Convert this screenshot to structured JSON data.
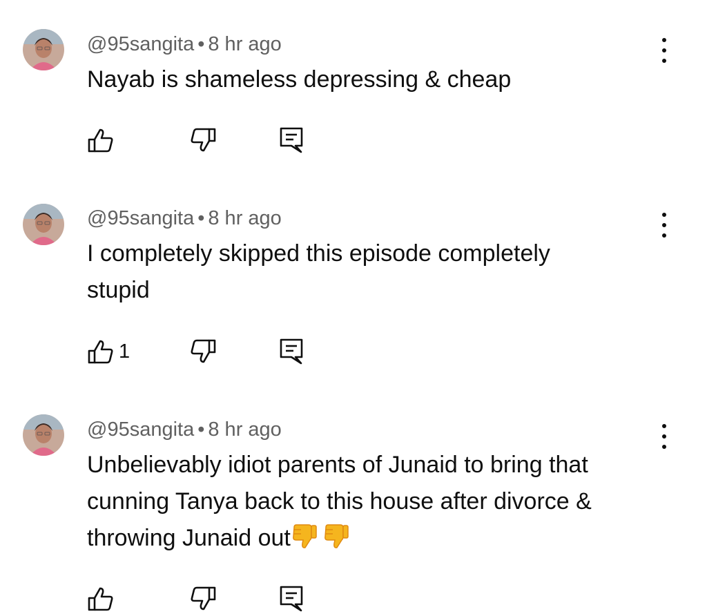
{
  "comments": [
    {
      "author": "@95sangita",
      "separator": "•",
      "time": "8 hr ago",
      "text_lines": [
        "Nayab is shameless depressing & cheap"
      ],
      "like_count": "",
      "emojis": []
    },
    {
      "author": "@95sangita",
      "separator": "•",
      "time": "8 hr ago",
      "text_lines": [
        "I completely skipped this episode completely",
        "stupid"
      ],
      "like_count": "1",
      "emojis": []
    },
    {
      "author": "@95sangita",
      "separator": "•",
      "time": "8 hr ago",
      "text_lines": [
        "Unbelievably idiot parents of Junaid to bring that",
        "cunning Tanya back to this house after divorce &",
        "throwing Junaid out"
      ],
      "like_count": "",
      "emojis": [
        "thumbs-down-emoji",
        "thumbs-down-emoji"
      ]
    }
  ],
  "icons": {
    "like": "thumb-up-icon",
    "dislike": "thumb-down-icon",
    "reply": "reply-icon",
    "menu": "more-vert-icon"
  },
  "colors": {
    "text": "#0f0f0f",
    "meta": "#606060",
    "emoji": "#f5b51e"
  }
}
